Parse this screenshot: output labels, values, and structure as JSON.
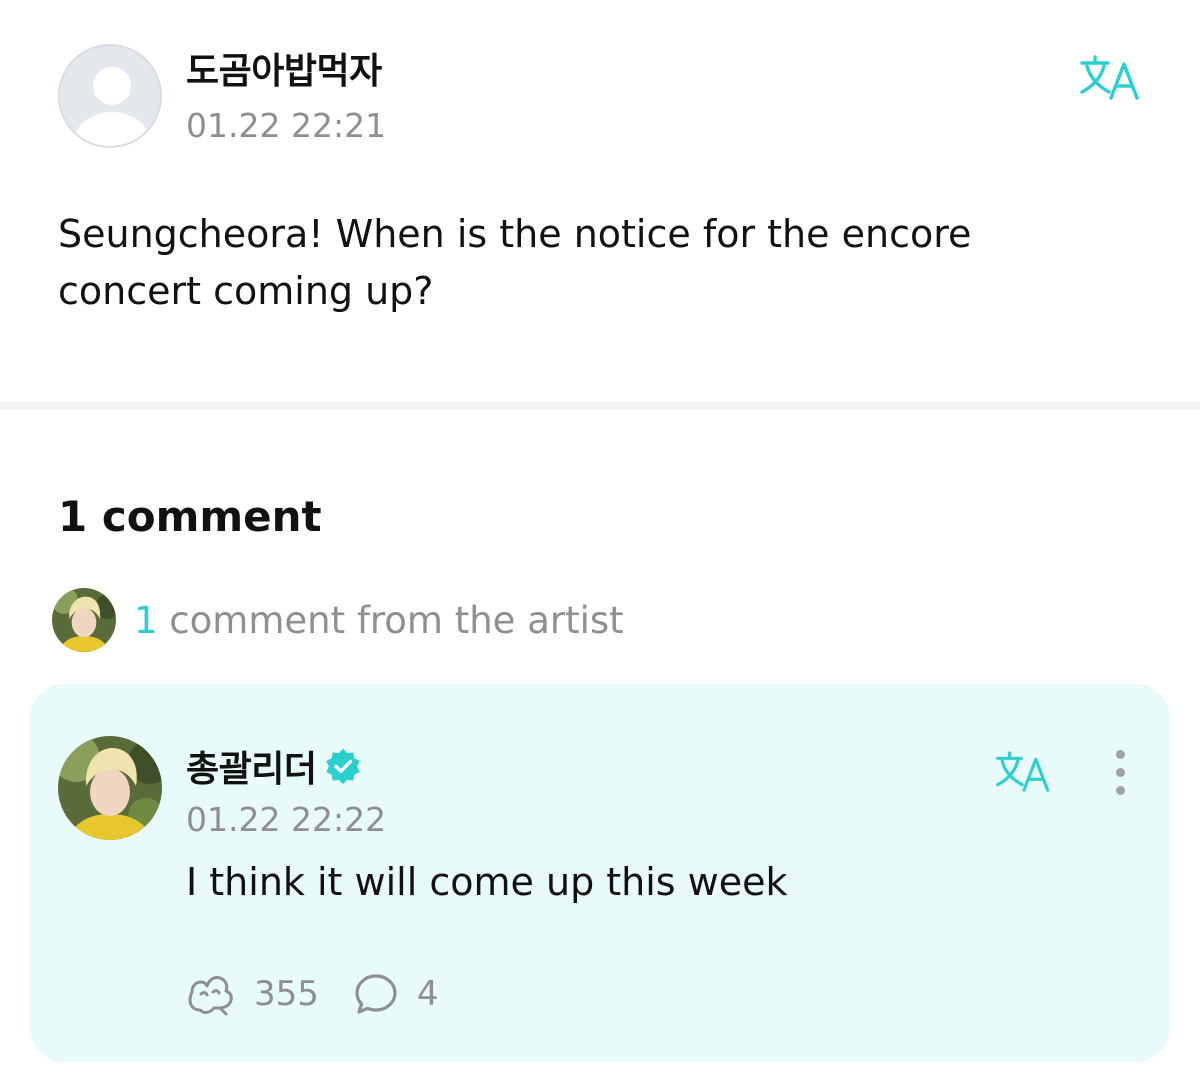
{
  "post": {
    "author": "도곰아밥먹자",
    "timestamp": "01.22 22:21",
    "text": "Seungcheora! When is the notice for the encore concert coming up?",
    "avatar_icon": "default-avatar-icon",
    "translate_icon": "translate-icon"
  },
  "comments_section": {
    "count_label": "1 comment",
    "artist_summary": {
      "count": "1",
      "label": " comment from the artist"
    }
  },
  "artist_comment": {
    "author": "총괄리더",
    "verified_icon": "verified-badge-icon",
    "timestamp": "01.22 22:22",
    "text": "I think it will come up this week",
    "likes": "355",
    "replies": "4",
    "like_icon": "like-icon",
    "reply_icon": "reply-bubble-icon",
    "more_icon": "more-vertical-icon"
  },
  "colors": {
    "accent": "#2ccfcf",
    "card_background": "#e8fafa",
    "secondary_text": "#8e8e93",
    "primary_text": "#111111"
  }
}
